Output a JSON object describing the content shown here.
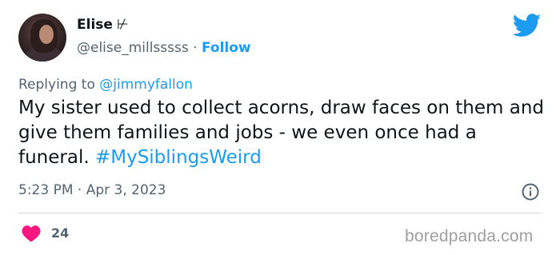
{
  "author": {
    "name": "Elise",
    "symbol": "⊬",
    "handle": "@elise_millsssss",
    "separator": "·",
    "follow_label": "Follow"
  },
  "reply": {
    "prefix": "Replying to",
    "mention": "@jimmyfallon"
  },
  "tweet": {
    "text": "My sister used to collect acorns, draw faces on them and give them families and jobs - we even once had a funeral.",
    "hashtag": "#MySiblingsWeird"
  },
  "meta": {
    "time": "5:23 PM",
    "separator": "·",
    "date": "Apr 3, 2023"
  },
  "engagement": {
    "likes": "24"
  },
  "watermark": "boredpanda.com",
  "colors": {
    "brand_blue": "#1d9bf0",
    "like_red": "#f91880",
    "secondary_text": "#536471"
  },
  "icons": {
    "logo": "twitter-bird-icon",
    "info": "info-icon",
    "like": "heart-icon"
  }
}
